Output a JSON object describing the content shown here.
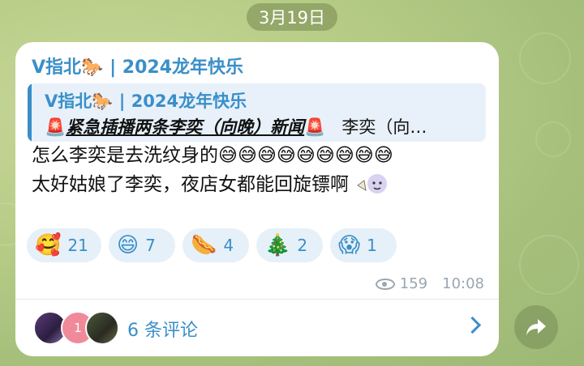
{
  "date": "3月19日",
  "message": {
    "sender": "V指北🐎 | 2024龙年快乐",
    "reply": {
      "title": "V指北🐎 | 2024龙年快乐",
      "icon_left": "🚨",
      "headline": "紧急插播两条李奕（向晚）新闻",
      "icon_right": "🚨",
      "preview": "李奕（向…"
    },
    "text_line1": "怎么李奕是去洗纹身的😅😅😅😅😅😅😅😅😅",
    "text_line2": "太好姑娘了李奕，夜店女都能回旋镖啊",
    "sticker_icon": "boy-sticker-icon",
    "reactions": [
      {
        "emoji": "🥰",
        "count": "21"
      },
      {
        "emoji": "😄",
        "count": "7"
      },
      {
        "emoji": "🌭",
        "count": "4"
      },
      {
        "emoji": "🎄",
        "count": "2"
      },
      {
        "emoji": "😱",
        "count": "1"
      }
    ],
    "views": "159",
    "time": "10:08"
  },
  "comments": {
    "avatar_badge": "1",
    "label": "6 条评论"
  },
  "colors": {
    "accent": "#3a8fc9",
    "reaction_bg": "#e6f0f9",
    "reply_bg": "#e8f1fa"
  }
}
